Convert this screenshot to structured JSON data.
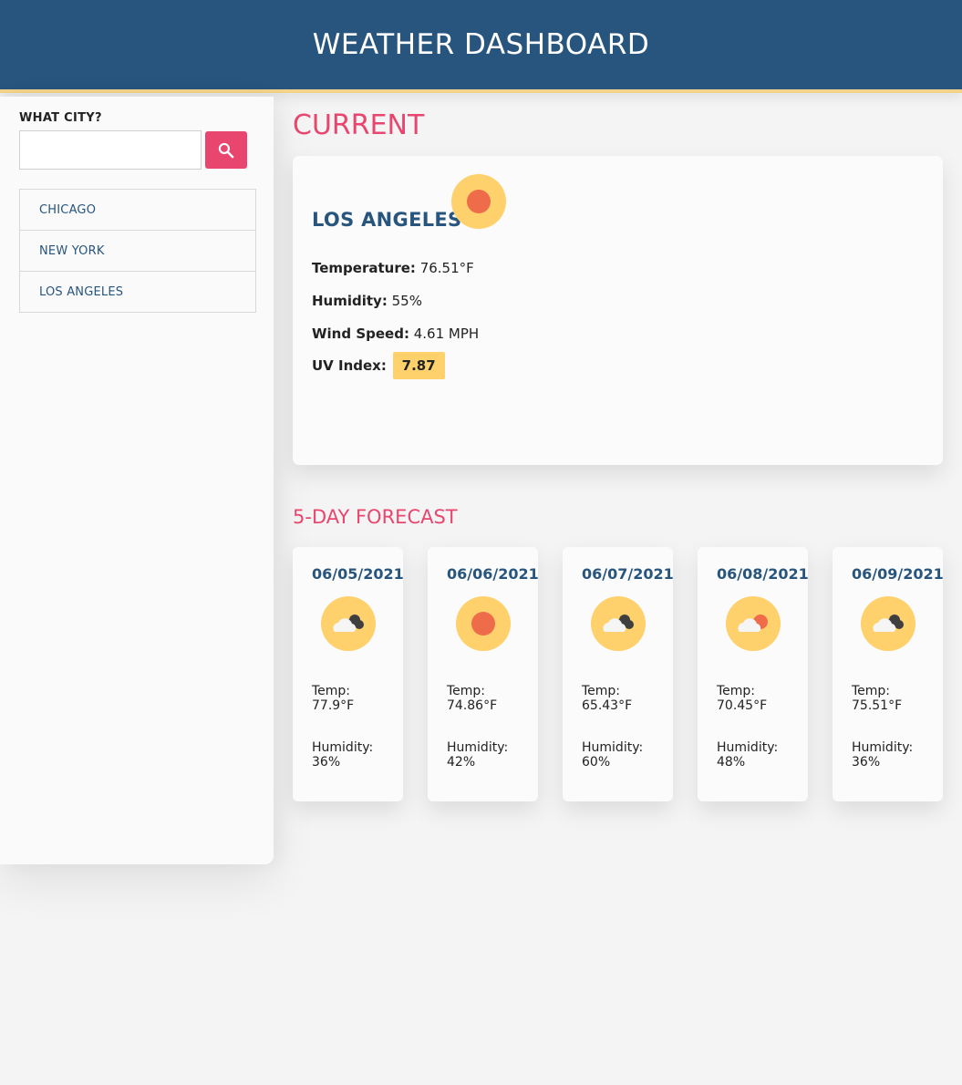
{
  "header": {
    "title": "WEATHER DASHBOARD"
  },
  "sidebar": {
    "search_label": "WHAT CITY?",
    "search_value": "",
    "search_icon": "search-icon",
    "cities": [
      "CHICAGO",
      "NEW YORK",
      "LOS ANGELES"
    ]
  },
  "current": {
    "section_title": "CURRENT",
    "city": "LOS ANGELES",
    "icon": "sun-icon",
    "temperature_label": "Temperature:",
    "temperature": "76.51°F",
    "humidity_label": "Humidity:",
    "humidity": "55%",
    "wind_label": "Wind Speed:",
    "wind": "4.61 MPH",
    "uv_label": "UV Index:",
    "uv": "7.87"
  },
  "forecast": {
    "section_title": "5-DAY FORECAST",
    "temp_label": "Temp:",
    "humidity_label": "Humidity:",
    "days": [
      {
        "date": "06/05/2021",
        "icon": "cloud-night-icon",
        "temp": "77.9°F",
        "humidity": "36%"
      },
      {
        "date": "06/06/2021",
        "icon": "sun-icon",
        "temp": "74.86°F",
        "humidity": "42%"
      },
      {
        "date": "06/07/2021",
        "icon": "cloud-night-icon",
        "temp": "65.43°F",
        "humidity": "60%"
      },
      {
        "date": "06/08/2021",
        "icon": "partly-cloudy-icon",
        "temp": "70.45°F",
        "humidity": "48%"
      },
      {
        "date": "06/09/2021",
        "icon": "cloud-night-icon",
        "temp": "75.51°F",
        "humidity": "36%"
      }
    ]
  },
  "colors": {
    "header_bg": "#27557d",
    "accent_pink": "#e8466f",
    "city_blue": "#27557d",
    "uv_yellow": "#fed16d",
    "icon_circle": "#fed16d",
    "sun_core": "#ef6c4a"
  }
}
